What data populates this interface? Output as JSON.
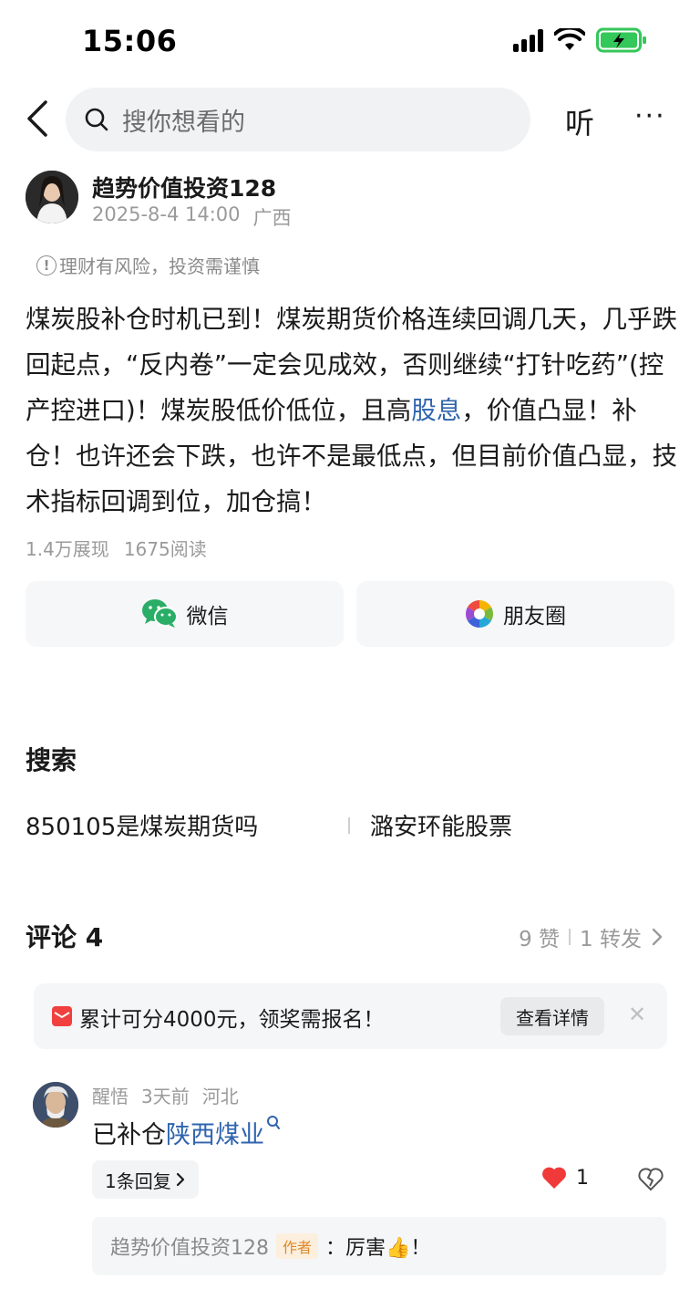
{
  "status_bar": {
    "time": "15:06"
  },
  "nav": {
    "search_placeholder": "搜你想看的",
    "listen_label": "听",
    "more_label": "···"
  },
  "author": {
    "name": "趋势价值投资128",
    "datetime": "2025-8-4 14:00",
    "location": "广西"
  },
  "risk_notice": "理财有风险，投资需谨慎",
  "article": {
    "text_before": "煤炭股补仓时机已到！煤炭期货价格连续回调几天，几乎跌回起点，“反内卷”一定会见成效，否则继续“打针吃药”(控产控进口)！煤炭股低价低位，且高",
    "keyword": "股息",
    "text_after": "，价值凸显！补仓！也许还会下跌，也许不是最低点，但目前价值凸显，技术指标回调到位，加仓搞！"
  },
  "stats": {
    "views": "1.4万展现",
    "reads": "1675阅读"
  },
  "share": {
    "wechat": "微信",
    "moments": "朋友圈"
  },
  "search_section": {
    "title": "搜索",
    "suggestions": [
      "850105是煤炭期货吗",
      "潞安环能股票"
    ]
  },
  "comments": {
    "title": "评论 4",
    "likes": "9 赞",
    "shares": "1 转发"
  },
  "promo": {
    "text": "累计可分4000元，领奖需报名！",
    "button": "查看详情",
    "close": "✕"
  },
  "comment_1": {
    "user": "醒悟",
    "time": "3天前",
    "location": "河北",
    "text_prefix": "已补仓",
    "keyword": "陕西煤业",
    "replies_button": "1条回复",
    "like_count": "1",
    "reply_preview": {
      "author": "趋势价值投资128",
      "tag": "作者",
      "text": "：厉害👍！"
    }
  },
  "colors": {
    "link": "#2f64ad",
    "like_heart": "#f03a3a",
    "battery": "#34c759",
    "author_tag": "#e0882a"
  }
}
